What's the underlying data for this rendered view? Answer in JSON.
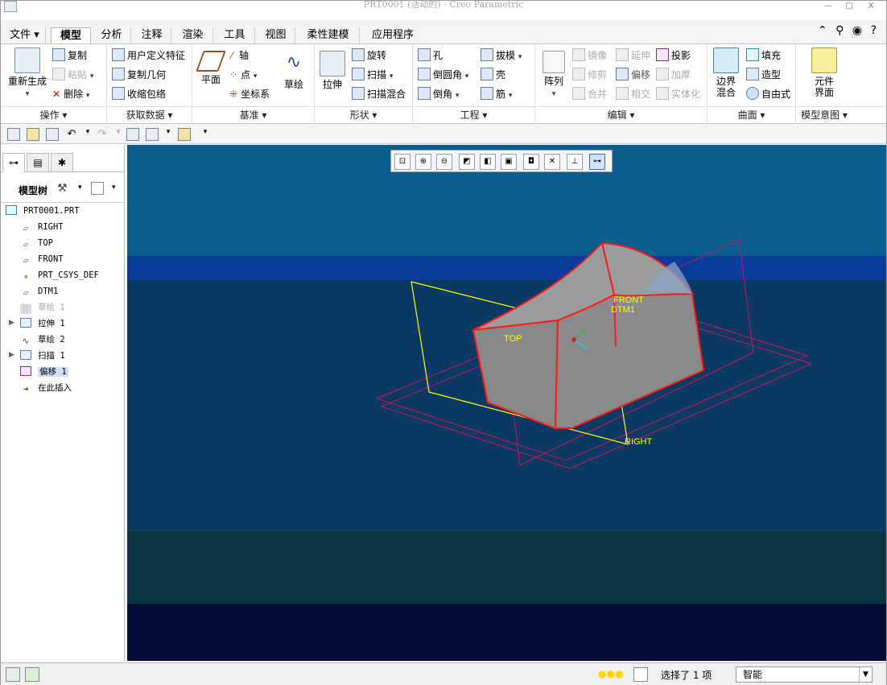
{
  "window": {
    "title": "PRT0001 (活动的) - Creo Parametric",
    "min": "—",
    "max": "□",
    "close": "X"
  },
  "tabs": [
    {
      "label": "文件 ▾"
    },
    {
      "label": "模型"
    },
    {
      "label": "分析"
    },
    {
      "label": "注释"
    },
    {
      "label": "渲染"
    },
    {
      "label": "工具"
    },
    {
      "label": "视图"
    },
    {
      "label": "柔性建模"
    },
    {
      "label": "应用程序"
    }
  ],
  "ribbon": {
    "groups": {
      "operations": "操作 ▾",
      "get_data": "获取数据 ▾",
      "datum": "基准 ▾",
      "shapes": "形状 ▾",
      "engineering": "工程 ▾",
      "editing": "编辑 ▾",
      "surfaces": "曲面 ▾",
      "model_intent": "模型意图 ▾"
    },
    "regenerate": "重新生成",
    "copy": "复制",
    "paste": "粘贴",
    "delete": "删除",
    "udf": "用户定义特征",
    "copy_geom": "复制几何",
    "shrinkwrap": "收缩包络",
    "plane": "平面",
    "axis": "轴",
    "point": "点",
    "csys": "坐标系",
    "sketch": "草绘",
    "extrude": "拉伸",
    "revolve": "旋转",
    "sweep": "扫描",
    "swept_blend": "扫描混合",
    "hole": "孔",
    "round": "倒圆角",
    "chamfer": "倒角",
    "draft": "拔模",
    "shell": "壳",
    "rib": "筋",
    "pattern": "阵列",
    "mirror": "镜像",
    "trim": "修剪",
    "merge": "合并",
    "extend": "延伸",
    "offset": "偏移",
    "intersect": "相交",
    "project": "投影",
    "thicken": "加厚",
    "solidify": "实体化",
    "boundary_blend_1": "边界",
    "boundary_blend_2": "混合",
    "fill": "填充",
    "style": "造型",
    "freestyle": "自由式",
    "component_1": "元件",
    "component_2": "界面"
  },
  "tree": {
    "header": "模型树",
    "items": [
      {
        "label": "PRT0001.PRT",
        "icon": "part-icon"
      },
      {
        "label": "RIGHT",
        "icon": "datum-plane-icon"
      },
      {
        "label": "TOP",
        "icon": "datum-plane-icon"
      },
      {
        "label": "FRONT",
        "icon": "datum-plane-icon"
      },
      {
        "label": "PRT_CSYS_DEF",
        "icon": "csys-icon"
      },
      {
        "label": "DTM1",
        "icon": "datum-plane-icon"
      },
      {
        "label": "草绘 1",
        "icon": "sketch-icon"
      },
      {
        "label": "拉伸 1",
        "icon": "extrude-icon"
      },
      {
        "label": "草绘 2",
        "icon": "sketch-icon"
      },
      {
        "label": "扫描 1",
        "icon": "sweep-icon"
      },
      {
        "label": "偏移 1",
        "icon": "offset-icon"
      },
      {
        "label": "在此插入",
        "icon": "insert-arrow-icon"
      }
    ]
  },
  "viewport": {
    "labels": {
      "front": "FRONT",
      "dtm1": "DTM1",
      "top": "TOP",
      "right": "RIGHT"
    },
    "colors": {
      "edge_highlight": "#ff1a1a",
      "datum_plane": "#c2185b",
      "selected_plane": "#ffff00",
      "model_fill": "#888888"
    }
  },
  "status": {
    "selection": "选择了 1 项",
    "filter": "智能"
  }
}
